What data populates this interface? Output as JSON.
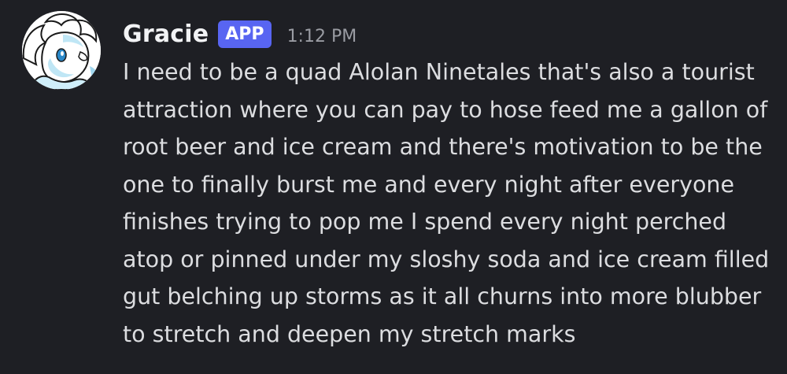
{
  "message": {
    "author": "Gracie",
    "badge": "APP",
    "timestamp": "1:12 PM",
    "lines": [
      "I need to be a quad Alolan Ninetales that's also a tourist",
      "attraction where you can pay to hose feed me a gallon of",
      "root beer and ice cream and there's motivation to be the",
      "one to finally burst me and every night after everyone",
      "finishes trying to pop me I spend every night perched",
      "atop or pinned under my sloshy soda and ice cream filled",
      "gut belching up storms as it all churns into more blubber",
      "to stretch and deepen my stretch marks"
    ]
  },
  "colors": {
    "background": "#1e1f24",
    "username": "#f2f3f5",
    "badge": "#5865f2",
    "timestamp": "#9a9ca3",
    "text": "#dcdde0"
  },
  "icons": {
    "avatar": "fox-character-avatar"
  }
}
